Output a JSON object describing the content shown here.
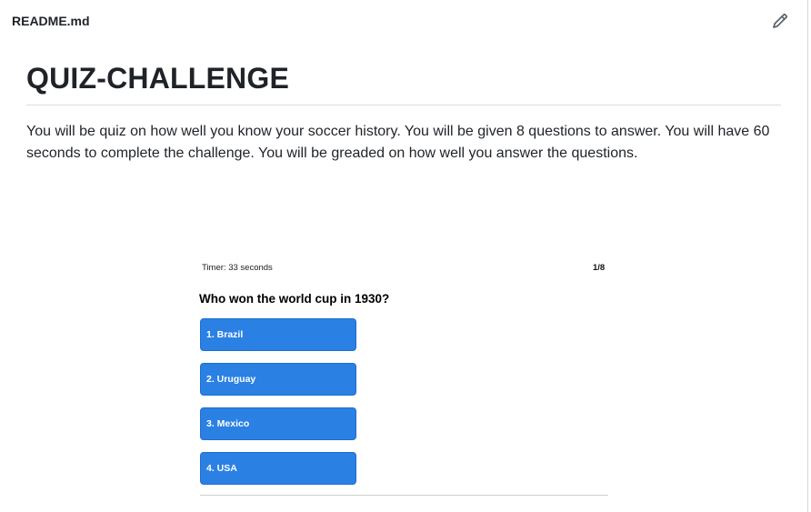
{
  "file_header": {
    "file_name": "README.md",
    "edit_icon": "pencil-icon"
  },
  "readme": {
    "title": "QUIZ-CHALLENGE",
    "description": "You will be quiz on how well you know your soccer history. You will be given 8 questions to answer. You will have 60 seconds to complete the challenge. You will be greaded on how well you answer the questions."
  },
  "quiz_screenshot": {
    "timer": "Timer: 33 seconds",
    "counter": "1/8",
    "question": "Who won the world cup in 1930?",
    "answers": [
      {
        "label": "1. Brazil"
      },
      {
        "label": "2. Uruguay"
      },
      {
        "label": "3. Mexico"
      },
      {
        "label": "4. USA"
      }
    ],
    "button_color": "#2b80e3"
  }
}
